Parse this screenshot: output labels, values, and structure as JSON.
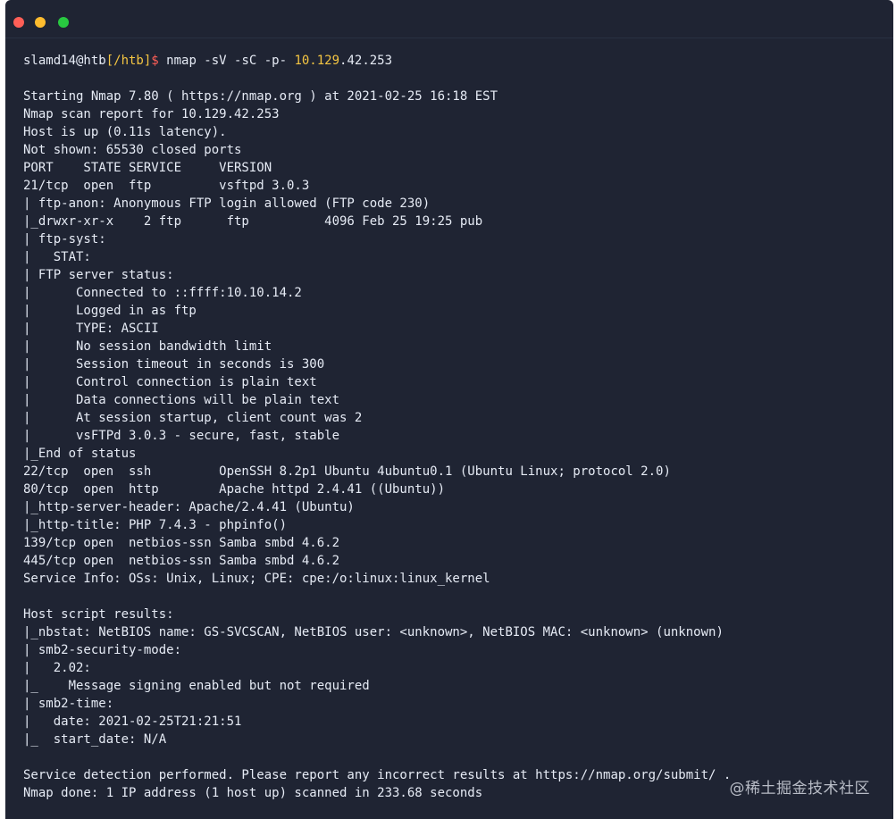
{
  "window": {
    "buttons": {
      "close_color": "#ff5f57",
      "minimize_color": "#febc2e",
      "zoom_color": "#28c840"
    }
  },
  "prompt": {
    "user_host": "slamd14@htb",
    "path": "[/htb]",
    "symbol": "$",
    "command": " nmap -sV -sC -p- ",
    "target_highlight": "10.129",
    "target_rest": ".42.253"
  },
  "output_lines": [
    "",
    "Starting Nmap 7.80 ( https://nmap.org ) at 2021-02-25 16:18 EST",
    "Nmap scan report for 10.129.42.253",
    "Host is up (0.11s latency).",
    "Not shown: 65530 closed ports",
    "PORT    STATE SERVICE     VERSION",
    "21/tcp  open  ftp         vsftpd 3.0.3",
    "| ftp-anon: Anonymous FTP login allowed (FTP code 230)",
    "|_drwxr-xr-x    2 ftp      ftp          4096 Feb 25 19:25 pub",
    "| ftp-syst:",
    "|   STAT:",
    "| FTP server status:",
    "|      Connected to ::ffff:10.10.14.2",
    "|      Logged in as ftp",
    "|      TYPE: ASCII",
    "|      No session bandwidth limit",
    "|      Session timeout in seconds is 300",
    "|      Control connection is plain text",
    "|      Data connections will be plain text",
    "|      At session startup, client count was 2",
    "|      vsFTPd 3.0.3 - secure, fast, stable",
    "|_End of status",
    "22/tcp  open  ssh         OpenSSH 8.2p1 Ubuntu 4ubuntu0.1 (Ubuntu Linux; protocol 2.0)",
    "80/tcp  open  http        Apache httpd 2.4.41 ((Ubuntu))",
    "|_http-server-header: Apache/2.4.41 (Ubuntu)",
    "|_http-title: PHP 7.4.3 - phpinfo()",
    "139/tcp open  netbios-ssn Samba smbd 4.6.2",
    "445/tcp open  netbios-ssn Samba smbd 4.6.2",
    "Service Info: OSs: Unix, Linux; CPE: cpe:/o:linux:linux_kernel",
    "",
    "Host script results:",
    "|_nbstat: NetBIOS name: GS-SVCSCAN, NetBIOS user: <unknown>, NetBIOS MAC: <unknown> (unknown)",
    "| smb2-security-mode:",
    "|   2.02:",
    "|_    Message signing enabled but not required",
    "| smb2-time:",
    "|   date: 2021-02-25T21:21:51",
    "|_  start_date: N/A",
    "",
    "Service detection performed. Please report any incorrect results at https://nmap.org/submit/ .",
    "Nmap done: 1 IP address (1 host up) scanned in 233.68 seconds"
  ],
  "watermark": "@稀土掘金技术社区"
}
